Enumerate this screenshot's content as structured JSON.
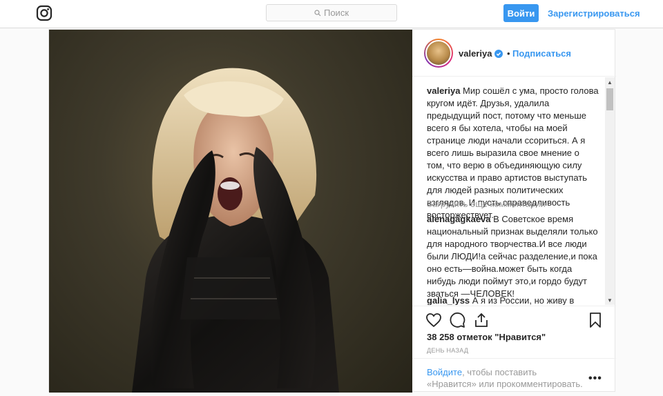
{
  "header": {
    "search_placeholder": "Поиск",
    "login_label": "Войти",
    "signup_label": "Зарегистрироваться"
  },
  "post": {
    "author": "valeriya",
    "separator": "•",
    "follow_label": "Подписаться",
    "caption": {
      "user": "valeriya",
      "text": " Мир сошёл с ума, просто голова кругом идёт. Друзья, удалила предыдущий пост, потому что меньше всего я бы хотела, чтобы на моей странице люди начали ссориться. А я всего лишь выразила свое мнение о том, что верю в объединяющую силу искусства и право артистов выступать для людей разных политических взглядов. И пусть справедливость восторжествует."
    },
    "load_more": "Загрузить еще комментарии",
    "comments": [
      {
        "user": "alenagagkaeva",
        "text": " В Советское время национальный признак выделяли только для народного творчества.И все люди были ЛЮДИ!а сейчас разделение,и пока оно есть—война.может быть когда нибудь люди поймут это,и гордо будут зваться —ЧЕЛОВЕК!"
      },
      {
        "user": "galia_lyss",
        "text": " А я из России, но живу в"
      }
    ],
    "likes": "38 258 отметок \"Нравится\"",
    "time": "день назад",
    "footer": {
      "login_link": "Войдите",
      "rest": ", чтобы поставить «Нравится» или прокомментировать."
    },
    "more_label": "•••"
  },
  "colors": {
    "accent": "#3897f0",
    "text": "#262626",
    "muted": "#999999",
    "border": "#dbdbdb"
  }
}
